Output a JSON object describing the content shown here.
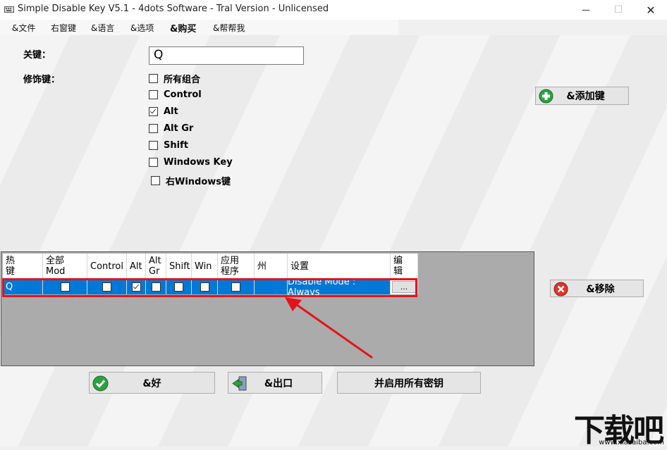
{
  "window": {
    "title": "Simple Disable Key V5.1 - 4dots Software - Tral Version - Unlicensed",
    "minimize": "—",
    "maximize": "☐",
    "close": "✕"
  },
  "menu": [
    "&文件",
    "右窗键",
    "&语言",
    "&选项",
    "&购买",
    "&帮帮我"
  ],
  "form": {
    "key_label": "关键：",
    "key_value": "Q",
    "modifiers_label": "修饰键：",
    "modifiers": [
      {
        "label": "所有组合",
        "checked": false
      },
      {
        "label": "Control",
        "checked": false
      },
      {
        "label": "Alt",
        "checked": true
      },
      {
        "label": "Alt Gr",
        "checked": false
      },
      {
        "label": "Shift",
        "checked": false
      },
      {
        "label": "Windows Key",
        "checked": false
      },
      {
        "label": "右Windows键",
        "checked": false
      }
    ]
  },
  "buttons": {
    "add": "&添加键",
    "remove": "&移除",
    "ok": "&好",
    "exit": "&出口",
    "enable_all": "并启用所有密钥"
  },
  "grid": {
    "columns": [
      "热\n键",
      "全部\nMod",
      "Control",
      "Alt",
      "Alt\nGr",
      "Shift",
      "Win",
      "应用\n程序",
      "州",
      "设置",
      "编\n辑"
    ],
    "rows": [
      {
        "hotkey": "Q",
        "all_mod": false,
        "control": false,
        "alt": true,
        "alt_gr": false,
        "shift": false,
        "win": false,
        "app": false,
        "state": "",
        "settings": "Disable Mode : Always",
        "edit": "..."
      }
    ]
  },
  "watermark": {
    "text": "下载吧",
    "sub": "www.xiazaiba.com"
  },
  "colors": {
    "selection": "#0078d7",
    "highlight": "#e3131b",
    "grid_bg": "#ababab"
  }
}
